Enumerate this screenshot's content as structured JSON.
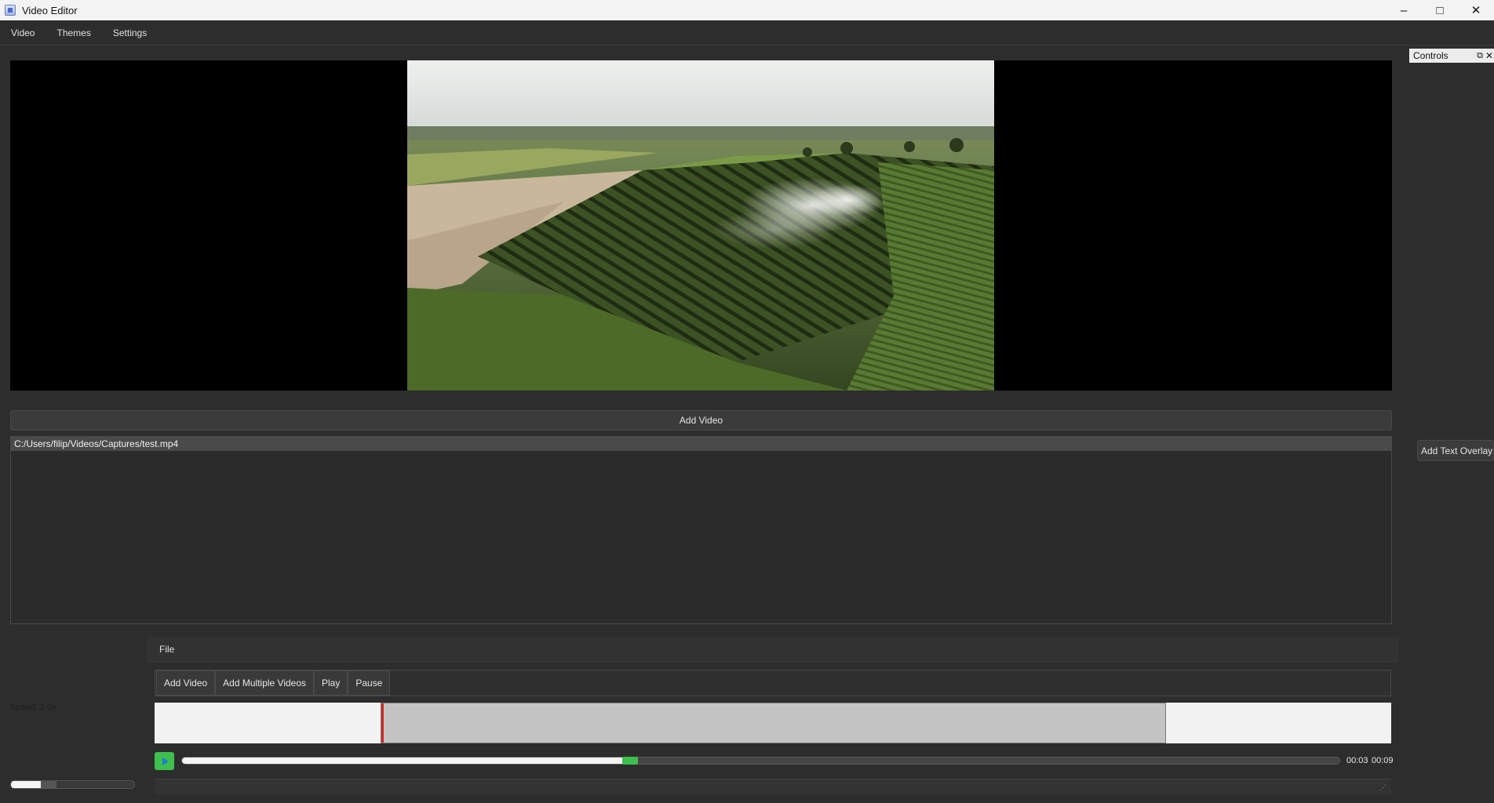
{
  "window": {
    "title": "Video Editor"
  },
  "menubar": {
    "items": [
      "Video",
      "Themes",
      "Settings"
    ]
  },
  "buttons": {
    "add_video_wide": "Add Video"
  },
  "file_list": {
    "items": [
      "C:/Users/filip/Videos/Captures/test.mp4"
    ]
  },
  "dock": {
    "title": "Controls",
    "add_text_overlay": "Add Text Overlay"
  },
  "speed": {
    "label": "Speed: 1.0x",
    "level": 0.3
  },
  "inner_menu": {
    "file": "File"
  },
  "toolbar": {
    "add_video": "Add Video",
    "add_multiple": "Add Multiple Videos",
    "play": "Play",
    "pause": "Pause"
  },
  "timeline": {
    "clip_start_fraction": 0.183,
    "clip_end_fraction": 0.818
  },
  "playback": {
    "current_time": "00:03",
    "total_time": "00:09",
    "progress": 0.38
  },
  "colors": {
    "accent_green": "#3fbf4d",
    "clip_marker_red": "#d32727"
  }
}
